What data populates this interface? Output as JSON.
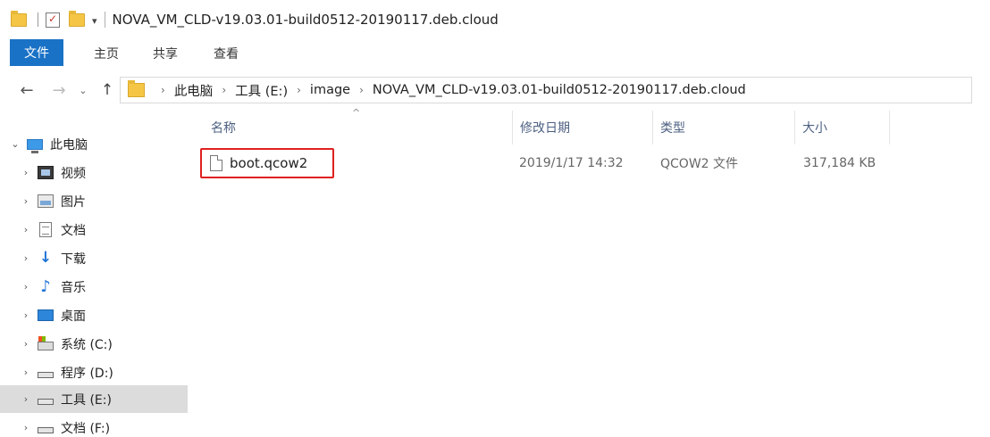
{
  "window": {
    "title": "NOVA_VM_CLD-v19.03.01-build0512-20190117.deb.cloud"
  },
  "quick_access": {
    "dropdown_glyph": "▾"
  },
  "ribbon": {
    "tabs": [
      "文件",
      "主页",
      "共享",
      "查看"
    ]
  },
  "address_bar": {
    "breadcrumbs": [
      "此电脑",
      "工具 (E:)",
      "image",
      "NOVA_VM_CLD-v19.03.01-build0512-20190117.deb.cloud"
    ],
    "separator": "›"
  },
  "nav_glyphs": {
    "back": "←",
    "forward": "→",
    "recent": "⌄",
    "up": "↑",
    "expanded": "⌄",
    "collapsed": "›"
  },
  "sidebar": {
    "items": [
      {
        "label": "此电脑",
        "icon": "pc-icon"
      },
      {
        "label": "视频",
        "icon": "video-icon"
      },
      {
        "label": "图片",
        "icon": "pictures-icon"
      },
      {
        "label": "文档",
        "icon": "documents-icon"
      },
      {
        "label": "下载",
        "icon": "download-icon"
      },
      {
        "label": "音乐",
        "icon": "music-icon"
      },
      {
        "label": "桌面",
        "icon": "desktop-icon"
      },
      {
        "label": "系统 (C:)",
        "icon": "system-drive-icon"
      },
      {
        "label": "程序 (D:)",
        "icon": "drive-icon"
      },
      {
        "label": "工具 (E:)",
        "icon": "drive-icon",
        "selected": true
      },
      {
        "label": "文档 (F:)",
        "icon": "drive-icon"
      }
    ]
  },
  "columns": {
    "name": "名称",
    "date": "修改日期",
    "type": "类型",
    "size": "大小",
    "sort_glyph": "^"
  },
  "files": [
    {
      "name": "boot.qcow2",
      "date": "2019/1/17 14:32",
      "type": "QCOW2 文件",
      "size": "317,184 KB",
      "highlighted": true
    }
  ],
  "colors": {
    "accent": "#1a72c6",
    "highlight_border": "#e02020",
    "selected_bg": "#dcdcdc"
  }
}
